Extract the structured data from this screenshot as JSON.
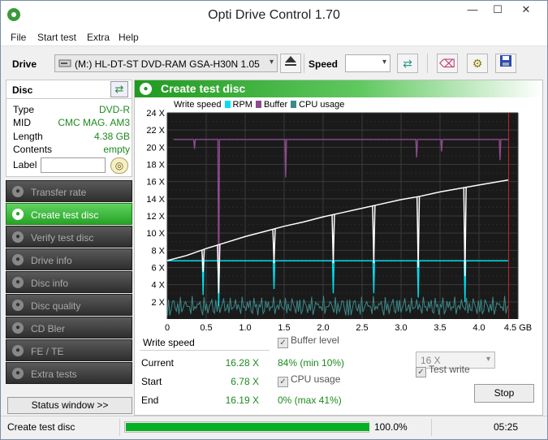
{
  "window": {
    "title": "Opti Drive Control 1.70",
    "min": "—",
    "max": "☐",
    "close": "✕"
  },
  "menu": [
    "File",
    "Start test",
    "Extra",
    "Help"
  ],
  "toolbar": {
    "drive_label": "Drive",
    "drive_value": "(M:)   HL-DT-ST DVD-RAM GSA-H30N 1.05",
    "speed_label": "Speed",
    "speed_value": ""
  },
  "disc": {
    "header": "Disc",
    "type_label": "Type",
    "type_value": "DVD-R",
    "mid_label": "MID",
    "mid_value": "CMC MAG. AM3",
    "length_label": "Length",
    "length_value": "4.38 GB",
    "contents_label": "Contents",
    "contents_value": "empty",
    "label_label": "Label",
    "label_value": ""
  },
  "nav": [
    {
      "label": "Transfer rate",
      "active": false
    },
    {
      "label": "Create test disc",
      "active": true
    },
    {
      "label": "Verify test disc",
      "active": false
    },
    {
      "label": "Drive info",
      "active": false
    },
    {
      "label": "Disc info",
      "active": false
    },
    {
      "label": "Disc quality",
      "active": false
    },
    {
      "label": "CD Bler",
      "active": false
    },
    {
      "label": "FE / TE",
      "active": false
    },
    {
      "label": "Extra tests",
      "active": false
    }
  ],
  "status_window_btn": "Status window >>",
  "panel": {
    "title": "Create test disc"
  },
  "colors": {
    "write_speed": "#ffffff",
    "rpm": "#00e0ee",
    "buffer": "#8e4a8e",
    "cpu": "#3d8a8a",
    "accent_green": "#26a326",
    "marker": "#cc2222"
  },
  "chart_data": {
    "type": "line",
    "legend": [
      {
        "name": "Write speed",
        "color": "#ffffff"
      },
      {
        "name": "RPM",
        "color": "#00e0ee"
      },
      {
        "name": "Buffer",
        "color": "#8e4a8e"
      },
      {
        "name": "CPU usage",
        "color": "#3d8a8a"
      }
    ],
    "xlim": [
      0,
      4.5
    ],
    "ylim": [
      0,
      24
    ],
    "x_ticks": [
      "0",
      "0.5",
      "1.0",
      "1.5",
      "2.0",
      "2.5",
      "3.0",
      "3.5",
      "4.0",
      "4.5 GB"
    ],
    "x_tick_values": [
      0,
      0.5,
      1.0,
      1.5,
      2.0,
      2.5,
      3.0,
      3.5,
      4.0,
      4.5
    ],
    "y_ticks": [
      "2 X",
      "4 X",
      "6 X",
      "8 X",
      "10 X",
      "12 X",
      "14 X",
      "16 X",
      "18 X",
      "20 X",
      "22 X",
      "24 X"
    ],
    "y_tick_values": [
      2,
      4,
      6,
      8,
      10,
      12,
      14,
      16,
      18,
      20,
      22,
      24
    ],
    "write_speed": {
      "x": [
        0,
        0.25,
        0.5,
        0.75,
        1.0,
        1.25,
        1.5,
        1.75,
        2.0,
        2.25,
        2.5,
        2.75,
        3.0,
        3.25,
        3.5,
        3.75,
        4.0,
        4.38
      ],
      "y": [
        6.8,
        7.4,
        8.2,
        8.9,
        9.6,
        10.2,
        10.8,
        11.3,
        11.9,
        12.4,
        12.9,
        13.4,
        13.9,
        14.3,
        14.8,
        15.2,
        15.6,
        16.2
      ]
    },
    "write_speed_dips": [
      {
        "x": 0.46,
        "y": 5.5
      },
      {
        "x": 0.66,
        "y": 3.0
      },
      {
        "x": 1.37,
        "y": 6.5
      },
      {
        "x": 2.13,
        "y": 6.5
      },
      {
        "x": 2.65,
        "y": 6.5
      },
      {
        "x": 3.22,
        "y": 6.0
      },
      {
        "x": 3.82,
        "y": 5.0
      }
    ],
    "rpm": {
      "y": 6.78
    },
    "rpm_dips": [
      {
        "x": 0.46,
        "y": 2.8
      },
      {
        "x": 0.66,
        "y": 1.5
      },
      {
        "x": 1.37,
        "y": 3.5
      },
      {
        "x": 2.13,
        "y": 3.0
      },
      {
        "x": 2.65,
        "y": 3.0
      },
      {
        "x": 3.22,
        "y": 2.5
      },
      {
        "x": 3.82,
        "y": 2.0
      }
    ],
    "buffer": {
      "y": 20.9,
      "min_y": 2.0
    },
    "buffer_drops": [
      {
        "x": 0.35,
        "y": 19.8
      },
      {
        "x": 1.52,
        "y": 16.5
      },
      {
        "x": 3.2,
        "y": 18.8
      },
      {
        "x": 3.52,
        "y": 19.5
      },
      {
        "x": 4.27,
        "y": 18.5
      }
    ],
    "buffer_spikes": [
      {
        "x": 0.66,
        "y": 2.0
      }
    ],
    "cpu": {
      "max_y": 4.1
    },
    "marker_x": 4.38
  },
  "stats": {
    "title": "Write speed",
    "current_label": "Current",
    "current_value": "16.28 X",
    "start_label": "Start",
    "start_value": "6.78 X",
    "end_label": "End",
    "end_value": "16.19 X",
    "buffer_level_label": "Buffer level",
    "buffer_level_value": "84% (min 10%)",
    "cpu_usage_label": "CPU usage",
    "cpu_usage_value": "0% (max 41%)",
    "speed_select": "16 X",
    "test_write_label": "Test write",
    "stop_btn": "Stop"
  },
  "statusbar": {
    "text": "Create test disc",
    "progress": 1.0,
    "percent": "100.0%",
    "time": "05:25"
  }
}
